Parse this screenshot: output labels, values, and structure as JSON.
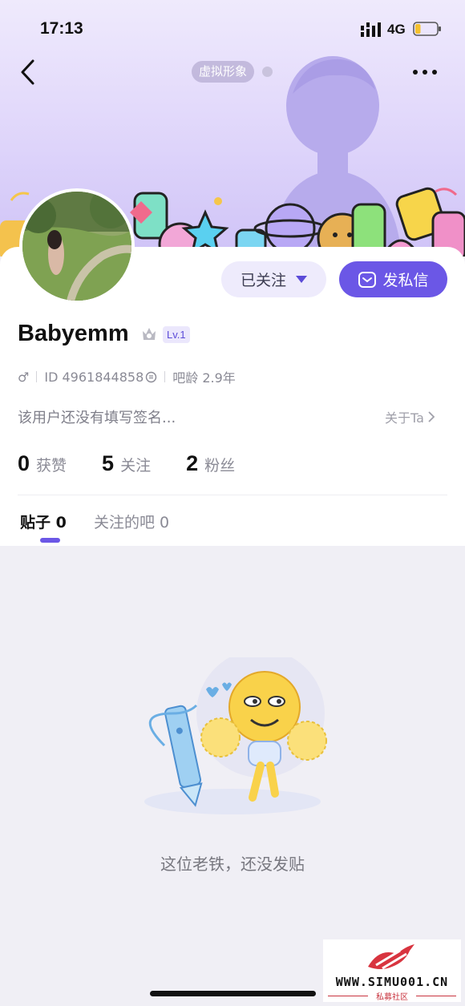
{
  "status_bar": {
    "time": "17:13",
    "network": "4G",
    "battery_level": 0.25
  },
  "header": {
    "avatar_chip_label": "虚拟形象"
  },
  "profile": {
    "username": "Babyemm",
    "level": "Lv.1",
    "gender_symbol": "♂",
    "id_text": "ID 4961844858",
    "forum_age": "吧龄 2.9年",
    "signature": "该用户还没有填写签名...",
    "about_label": "关于Ta"
  },
  "actions": {
    "follow_label": "已关注",
    "message_label": "发私信"
  },
  "stats": [
    {
      "value": "0",
      "label": "获赞"
    },
    {
      "value": "5",
      "label": "关注"
    },
    {
      "value": "2",
      "label": "粉丝"
    }
  ],
  "tabs": [
    {
      "label": "贴子 0",
      "active": true
    },
    {
      "label": "关注的吧 0",
      "active": false
    }
  ],
  "empty_state": {
    "message": "这位老铁，还没发贴"
  },
  "watermark": {
    "url": "WWW.SIMU001.CN",
    "subtitle": "私募社区"
  },
  "colors": {
    "accent": "#6b57e6",
    "banner_top": "#efeafc",
    "banner_bottom": "#cfc3f7",
    "background": "#f0eff5"
  },
  "icons": [
    "back-arrow-icon",
    "more-dots-icon",
    "crown-icon",
    "copy-icon",
    "chevron-right-icon",
    "envelope-icon",
    "caret-down-icon",
    "signal-icon",
    "battery-icon"
  ]
}
